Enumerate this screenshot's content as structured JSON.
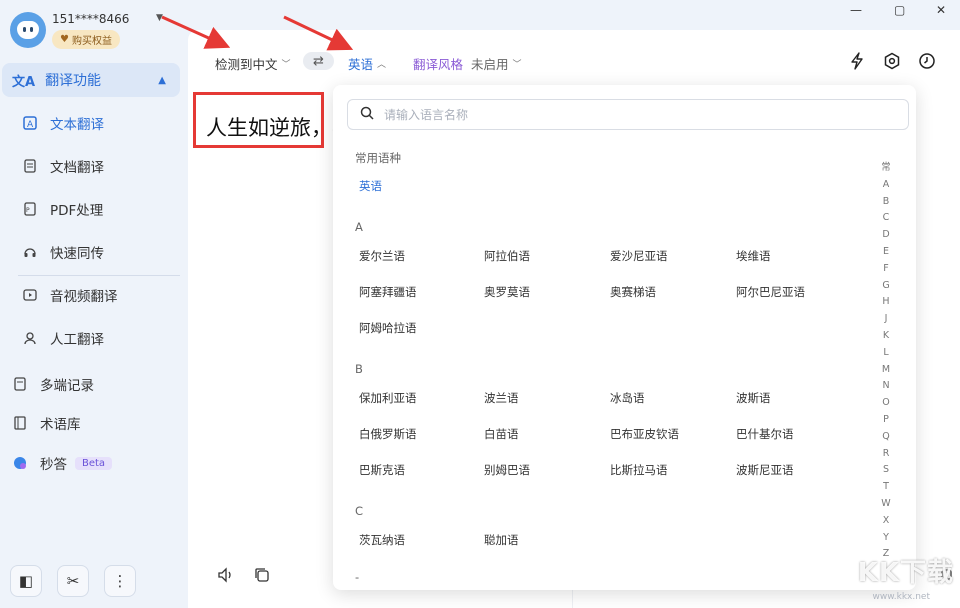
{
  "user": {
    "phone": "151****8466",
    "vip_label": "购买权益"
  },
  "sidebar": {
    "group_label": "翻译功能",
    "items": [
      {
        "label": "文本翻译"
      },
      {
        "label": "文档翻译"
      },
      {
        "label": "PDF处理"
      },
      {
        "label": "快速同传"
      },
      {
        "label": "音视频翻译"
      },
      {
        "label": "人工翻译"
      }
    ],
    "extra": [
      {
        "label": "多端记录"
      },
      {
        "label": "术语库"
      },
      {
        "label": "秒答",
        "badge": "Beta"
      }
    ]
  },
  "toolbar": {
    "source_lang": "检测到中文",
    "target_lang": "英语",
    "style_label": "翻译风格",
    "style_value": "未启用"
  },
  "editor": {
    "source_text": "人生如逆旅，我"
  },
  "lang_picker": {
    "search_placeholder": "请输入语言名称",
    "common_head": "常用语种",
    "common": [
      "英语"
    ],
    "sections": [
      {
        "letter": "A",
        "langs": [
          "爱尔兰语",
          "阿拉伯语",
          "爱沙尼亚语",
          "埃维语",
          "阿塞拜疆语",
          "奥罗莫语",
          "奥赛梯语",
          "阿尔巴尼亚语",
          "阿姆哈拉语"
        ]
      },
      {
        "letter": "B",
        "langs": [
          "保加利亚语",
          "波兰语",
          "冰岛语",
          "波斯语",
          "白俄罗斯语",
          "白苗语",
          "巴布亚皮钦语",
          "巴什基尔语",
          "巴斯克语",
          "别姆巴语",
          "比斯拉马语",
          "波斯尼亚语"
        ]
      },
      {
        "letter": "C",
        "langs": [
          "茨瓦纳语",
          "聪加语"
        ]
      }
    ],
    "next_letter": "-",
    "index": [
      "常",
      "A",
      "B",
      "C",
      "D",
      "E",
      "F",
      "G",
      "H",
      "J",
      "K",
      "L",
      "M",
      "N",
      "O",
      "P",
      "Q",
      "R",
      "S",
      "T",
      "W",
      "X",
      "Y",
      "Z"
    ]
  },
  "watermark": {
    "text": "KK下载",
    "url": "www.kkx.net"
  },
  "colors": {
    "accent": "#2d6fd6",
    "annotation": "#e53935"
  }
}
